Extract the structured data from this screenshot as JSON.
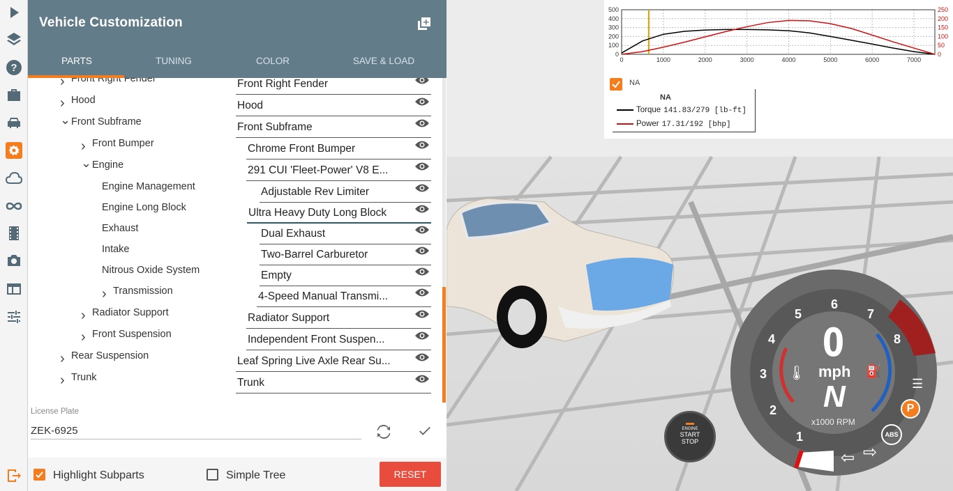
{
  "sidebar": {
    "items": [
      {
        "icon": "play-icon"
      },
      {
        "icon": "layers-icon"
      },
      {
        "icon": "help-icon"
      },
      {
        "icon": "briefcase-icon"
      },
      {
        "icon": "car-icon"
      },
      {
        "icon": "gear-icon",
        "active": true
      },
      {
        "icon": "cloud-icon"
      },
      {
        "icon": "infinity-icon"
      },
      {
        "icon": "film-icon"
      },
      {
        "icon": "camera-icon"
      },
      {
        "icon": "window-icon"
      },
      {
        "icon": "sliders-icon"
      }
    ],
    "exit_icon": "exit-icon"
  },
  "panel": {
    "title": "Vehicle Customization",
    "tabs": [
      "PARTS",
      "TUNING",
      "COLOR",
      "SAVE & LOAD"
    ],
    "active_tab": "PARTS",
    "tree": [
      {
        "label": "Front Right Fender",
        "value": "Front Right Fender",
        "expanded": false
      },
      {
        "label": "Hood",
        "value": "Hood",
        "expanded": false
      },
      {
        "label": "Front Subframe",
        "value": "Front Subframe",
        "expanded": true
      },
      {
        "label": "Front Bumper",
        "value": "Chrome Front Bumper",
        "expanded": false
      },
      {
        "label": "Engine",
        "value": "291 CUI 'Fleet-Power' V8 E...",
        "expanded": true
      },
      {
        "label": "Engine Management",
        "value": "Adjustable Rev Limiter"
      },
      {
        "label": "Engine Long Block",
        "value": "Ultra Heavy Duty Long Block"
      },
      {
        "label": "Exhaust",
        "value": "Dual Exhaust"
      },
      {
        "label": "Intake",
        "value": "Two-Barrel Carburetor"
      },
      {
        "label": "Nitrous Oxide System",
        "value": "Empty"
      },
      {
        "label": "Transmission",
        "value": "4-Speed Manual Transmi...",
        "expanded": false
      },
      {
        "label": "Radiator Support",
        "value": "Radiator Support",
        "expanded": false
      },
      {
        "label": "Front Suspension",
        "value": "Independent Front Suspen...",
        "expanded": false
      },
      {
        "label": "Rear Suspension",
        "value": "Leaf Spring Live Axle Rear Su...",
        "expanded": false
      },
      {
        "label": "Trunk",
        "value": "Trunk",
        "expanded": false
      }
    ],
    "license": {
      "label": "License Plate",
      "value": "ZEK-6925"
    },
    "footer": {
      "highlight_label": "Highlight Subparts",
      "highlight_checked": true,
      "simple_label": "Simple Tree",
      "simple_checked": false,
      "reset_label": "RESET"
    }
  },
  "graph": {
    "na_label": "NA",
    "legend_title": "NA",
    "torque_label": "Torque",
    "torque_value": "141.83/279 [lb-ft]",
    "power_label": "Power",
    "power_value": "17.31/192  [bhp]",
    "left_ticks": [
      "500",
      "400",
      "300",
      "200",
      "100",
      "0"
    ],
    "right_ticks": [
      "250",
      "200",
      "150",
      "100",
      "50",
      "0"
    ],
    "x_ticks": [
      "0",
      "1000",
      "2000",
      "3000",
      "4000",
      "5000",
      "6000",
      "7000"
    ],
    "colors": {
      "torque": "#000000",
      "power": "#d01010",
      "rpm_marker": "#e0a000"
    }
  },
  "chart_data": {
    "type": "line",
    "x": [
      0,
      500,
      1000,
      1500,
      2000,
      2500,
      3000,
      3500,
      4000,
      4500,
      5000,
      5500,
      6000,
      6500,
      7000,
      7500
    ],
    "series": [
      {
        "name": "Torque",
        "values": [
          15,
          150,
          225,
          258,
          272,
          278,
          278,
          274,
          265,
          240,
          200,
          158,
          115,
          70,
          30,
          0
        ]
      },
      {
        "name": "Power",
        "values": [
          0,
          15,
          40,
          68,
          98,
          128,
          155,
          178,
          190,
          188,
          172,
          145,
          108,
          70,
          35,
          0
        ]
      }
    ],
    "xlim": [
      0,
      7500
    ],
    "ylim_left": [
      0,
      500
    ],
    "ylim_right": [
      0,
      250
    ],
    "rpm_marker": 650
  },
  "dash": {
    "speed": "0",
    "unit": "mph",
    "gear": "N",
    "rpm_label": "x1000 RPM",
    "rpm_ticks": [
      "1",
      "2",
      "3",
      "4",
      "5",
      "6",
      "7",
      "8"
    ],
    "parking": "P",
    "abs": "ABS",
    "engine_btn": [
      "ENGINE",
      "START",
      "STOP"
    ]
  }
}
